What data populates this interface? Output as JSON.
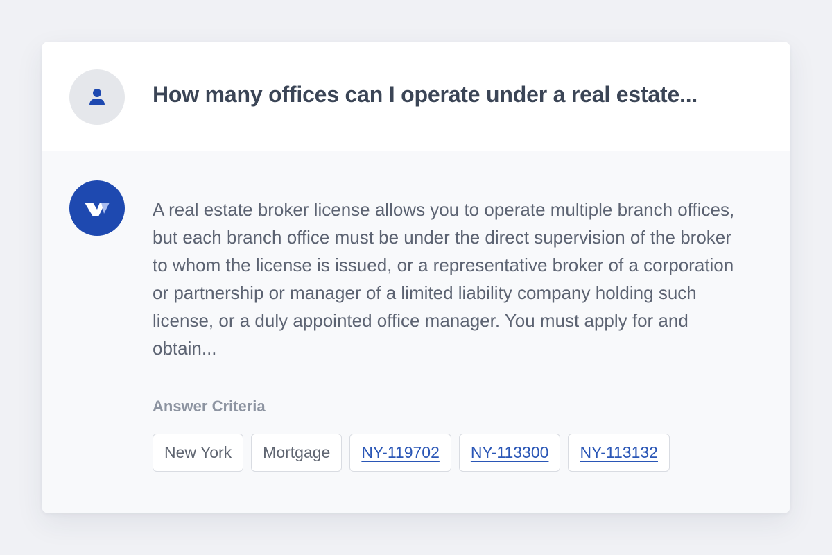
{
  "question": {
    "text": "How many offices can I operate under a real estate...",
    "avatar_icon": "user-icon"
  },
  "answer": {
    "avatar_icon": "brand-logo-icon",
    "text": "A real estate broker license allows you to operate multiple branch offices, but each branch office must be under the direct supervision of the broker to whom the license is issued, or a representative broker of a corporation or partnership or manager of a limited liability company holding such license, or a duly appointed office manager. You must apply for and obtain..."
  },
  "criteria": {
    "title": "Answer Criteria",
    "tags": [
      {
        "label": "New York",
        "is_link": false
      },
      {
        "label": "Mortgage",
        "is_link": false
      },
      {
        "label": "NY-119702",
        "is_link": true
      },
      {
        "label": "NY-113300",
        "is_link": true
      },
      {
        "label": "NY-113132",
        "is_link": true
      }
    ]
  },
  "colors": {
    "accent": "#1e49b0",
    "link": "#2a56b6",
    "heading": "#3b4556",
    "body_text": "#5c6372"
  }
}
